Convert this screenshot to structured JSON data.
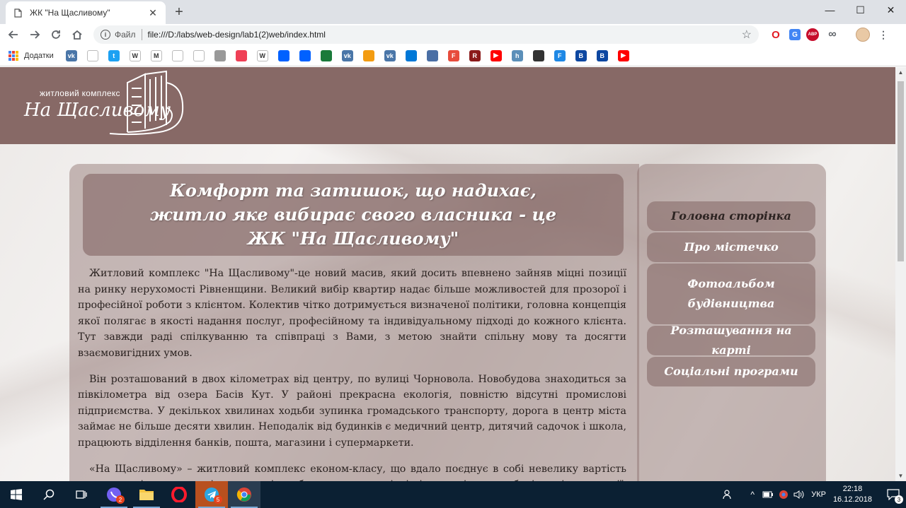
{
  "browser": {
    "tab_title": "ЖК \"На Щасливому\"",
    "new_tab_symbol": "+",
    "window_controls": [
      "—",
      "☐",
      "✕"
    ],
    "omnibox": {
      "scheme_label": "Файл",
      "url": "file:///D:/labs/web-design/lab1(2)web/index.html"
    },
    "bookmarks_apps_label": "Додатки",
    "bookmarks": [
      {
        "icon": "vk-icon",
        "text": "vk",
        "color": "#4a76a8"
      },
      {
        "icon": "page-icon",
        "text": "",
        "color": "#ffffff"
      },
      {
        "icon": "twitter-icon",
        "text": "t",
        "color": "#1da1f2"
      },
      {
        "icon": "wikipedia-icon",
        "text": "W",
        "color": "#ffffff"
      },
      {
        "icon": "gmail-icon",
        "text": "M",
        "color": "#ffffff"
      },
      {
        "icon": "chrome-ring-icon",
        "text": "",
        "color": "#ffffff"
      },
      {
        "icon": "bird-icon",
        "text": "",
        "color": "#ffffff"
      },
      {
        "icon": "image-icon",
        "text": "",
        "color": "#999999"
      },
      {
        "icon": "pocket-icon",
        "text": "",
        "color": "#ef4056"
      },
      {
        "icon": "weibo-icon",
        "text": "W",
        "color": "#ffffff"
      },
      {
        "icon": "dropbox-icon",
        "text": "",
        "color": "#0061ff"
      },
      {
        "icon": "dropbox-icon",
        "text": "",
        "color": "#0061ff"
      },
      {
        "icon": "bars-icon",
        "text": "",
        "color": "#1a7a3a"
      },
      {
        "icon": "vk-icon",
        "text": "vk",
        "color": "#4a76a8"
      },
      {
        "icon": "orange-ball-icon",
        "text": "",
        "color": "#f39c12"
      },
      {
        "icon": "vk-icon",
        "text": "vk",
        "color": "#4a76a8"
      },
      {
        "icon": "cloud-icon",
        "text": "",
        "color": "#0078d7"
      },
      {
        "icon": "doc-icon",
        "text": "",
        "color": "#4a6fa5"
      },
      {
        "icon": "f-circle-icon",
        "text": "F",
        "color": "#e74c3c"
      },
      {
        "icon": "r-icon",
        "text": "R",
        "color": "#8b1a1a"
      },
      {
        "icon": "youtube-icon",
        "text": "▶",
        "color": "#ff0000"
      },
      {
        "icon": "h-icon",
        "text": "h",
        "color": "#5b8fb9"
      },
      {
        "icon": "drop-icon",
        "text": "",
        "color": "#333333"
      },
      {
        "icon": "f-square-icon",
        "text": "F",
        "color": "#1e88e5"
      },
      {
        "icon": "b-icon",
        "text": "B",
        "color": "#0d47a1"
      },
      {
        "icon": "b-icon",
        "text": "B",
        "color": "#0d47a1"
      },
      {
        "icon": "youtube-icon",
        "text": "▶",
        "color": "#ff0000"
      }
    ],
    "extensions": [
      {
        "icon": "opera-icon",
        "text": "O",
        "color": "#e31c23"
      },
      {
        "icon": "translate-icon",
        "text": "G",
        "color": "#4285f4"
      },
      {
        "icon": "adblock-icon",
        "text": "ABP",
        "color": "#c70d2c"
      },
      {
        "icon": "infinity-icon",
        "text": "∞",
        "color": "#5f6368"
      }
    ]
  },
  "site": {
    "logo_line1": "житловий комплекс",
    "logo_line2": "На Щасливому",
    "hero_title": "Комфорт та затишок, що надихає, житло яке вибирає свого власника - це ЖК \"На Щасливому\"",
    "paragraphs": [
      "Житловий комплекс \"На Щасливому\"-це новий масив, який досить впевнено зайняв міцні позиції на ринку нерухомості Рівненщини. Великий вибір квартир надає більше можливостей для прозорої і професійної роботи з клієнтом. Колектив чітко дотримується визначеної політики, головна концепція якої полягає в якості надання послуг, професійному та індивідуальному підході до кожного клієнта. Тут завжди раді спілкуванню та співпраці з Вами, з метою знайти спільну мову та досягти взаємовигідних умов.",
      "Він розташований в двох кілометрах від центру, по вулиці Чорновола. Новобудова знаходиться за півкілометра від озера Басів Кут. У районі прекрасна екологія, повністю відсутні промислові підприємства. У декількох хвилинах ходьби зупинка громадського транспорту, дорога в центр міста займає не більше десяти хвилин. Неподалік від будинків є медичний центр, дитячий садочок і школа, працюють відділення банків, пошта, магазини і супермаркети.",
      "«На Щасливому» – житловий комплекс економ-класу, що вдало поєднує в собі невелику вартість апартаментів, високу якість екологічно безпечних матеріалів і сучасні енергозберігаючі технології, які"
    ],
    "menu": [
      {
        "label": "Головна сторінка",
        "active": true
      },
      {
        "label": "Про містечко",
        "active": false
      },
      {
        "label": "Фотоальбом будівництва",
        "active": false
      },
      {
        "label": "Розташування на карті",
        "active": false
      },
      {
        "label": "Соціальні програми",
        "active": false
      }
    ]
  },
  "taskbar": {
    "apps": [
      {
        "name": "start-button",
        "icon": "windows-icon"
      },
      {
        "name": "search-button",
        "icon": "search-icon"
      },
      {
        "name": "task-view-button",
        "icon": "task-view-icon"
      },
      {
        "name": "viber-app",
        "icon": "viber-icon",
        "badge": "2"
      },
      {
        "name": "explorer-app",
        "icon": "folder-icon"
      },
      {
        "name": "opera-app",
        "icon": "opera-icon"
      },
      {
        "name": "telegram-app",
        "icon": "telegram-icon",
        "badge": "5"
      },
      {
        "name": "chrome-app",
        "icon": "chrome-icon"
      }
    ],
    "language": "УКР",
    "time": "22:18",
    "date": "16.12.2018",
    "notifications": "3"
  }
}
